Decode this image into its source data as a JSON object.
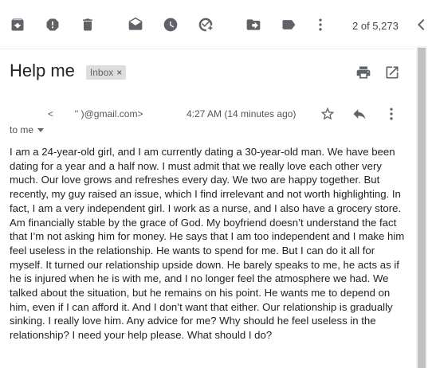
{
  "toolbar": {
    "icons": [
      "archive-icon",
      "report-spam-icon",
      "delete-icon",
      "mark-unread-icon",
      "snooze-icon",
      "add-task-icon",
      "move-to-icon",
      "labels-icon",
      "more-vert-icon"
    ],
    "counter": "2 of 5,273"
  },
  "message": {
    "subject": "Help me",
    "label": "Inbox",
    "label_close": "×",
    "sender": "<        '' )@gmail.com>",
    "time": "4:27 AM (14 minutes ago)",
    "recipient": "to me",
    "body": "I am a 24-year-old girl, and I am currently dating a 30-year-old man. We have been dating for a year and a half now. I must admit that we really love each other very much. Our love grows and refreshes every day. We two are happy together. But recently, my guy raised an issue, which I find irrelevant and not worth highlighting. In fact, I am a very independent girl. I work as a nurse, and I also have a grocery store. Am financially stable by the grace of God. My boyfriend doesn’t understand the fact that I’m not asking him for money. He says that I am too independent and I make him feel useless in the relationship. He wants to spend for me. But I can do it all for myself. It turned our relationship upside down. He barely speaks to me, he acts as if he is injured when he is with me, and I no longer feel the atmosphere we had. We talked about the situation, but he remains on his point. He wants me to depend on him, even if I can afford it. And I don’t want that either. Our relationship is gradually sinking. I really love him. Any advice for me? Why should he feel useless in the relationship? I need your help please. What should I do?"
  }
}
